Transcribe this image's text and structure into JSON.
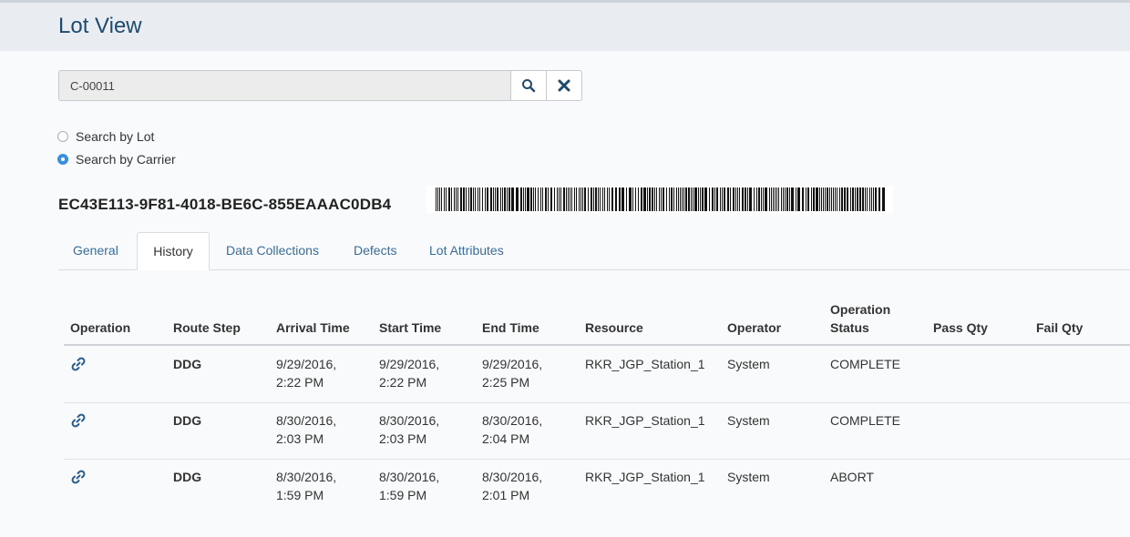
{
  "page": {
    "title": "Lot View"
  },
  "search": {
    "value": "C-00011"
  },
  "search_options": [
    {
      "label": "Search by Lot",
      "checked": false
    },
    {
      "label": "Search by Carrier",
      "checked": true
    }
  ],
  "lot": {
    "id": "EC43E113-9F81-4018-BE6C-855EAAAC0DB4"
  },
  "tabs": [
    "General",
    "History",
    "Data Collections",
    "Defects",
    "Lot Attributes"
  ],
  "active_tab": "History",
  "table": {
    "columns": [
      "Operation",
      "Route Step",
      "Arrival Time",
      "Start Time",
      "End Time",
      "Resource",
      "Operator",
      "Operation Status",
      "Pass Qty",
      "Fail Qty"
    ],
    "rows": [
      {
        "operation_icon": "link-icon",
        "route_step": "DDG",
        "arrival_time": "9/29/2016, 2:22 PM",
        "start_time": "9/29/2016, 2:22 PM",
        "end_time": "9/29/2016, 2:25 PM",
        "resource": "RKR_JGP_Station_1",
        "operator": "System",
        "status": "COMPLETE",
        "pass_qty": "",
        "fail_qty": ""
      },
      {
        "operation_icon": "link-icon",
        "route_step": "DDG",
        "arrival_time": "8/30/2016, 2:03 PM",
        "start_time": "8/30/2016, 2:03 PM",
        "end_time": "8/30/2016, 2:04 PM",
        "resource": "RKR_JGP_Station_1",
        "operator": "System",
        "status": "COMPLETE",
        "pass_qty": "",
        "fail_qty": ""
      },
      {
        "operation_icon": "link-icon",
        "route_step": "DDG",
        "arrival_time": "8/30/2016, 1:59 PM",
        "start_time": "8/30/2016, 1:59 PM",
        "end_time": "8/30/2016, 2:01 PM",
        "resource": "RKR_JGP_Station_1",
        "operator": "System",
        "status": "ABORT",
        "pass_qty": "",
        "fail_qty": ""
      }
    ]
  },
  "icons": {
    "search_button": "search-icon",
    "clear_button": "close-icon"
  },
  "colors": {
    "accent": "#3a6c99",
    "title": "#1e4a6e",
    "radio_selected": "#3b8fe0",
    "header_bg": "#e9edf2"
  }
}
